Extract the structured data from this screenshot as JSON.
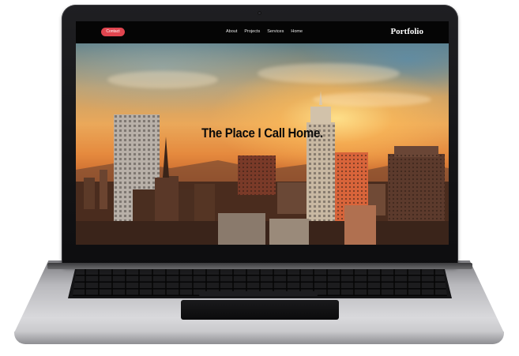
{
  "site": {
    "contact_label": "Contact",
    "nav": [
      "About",
      "Projects",
      "Services",
      "Home"
    ],
    "brand": "Portfolio"
  },
  "hero": {
    "title": "The Place I Call Home."
  },
  "colors": {
    "contact_button": "#e0454f",
    "nav_background": "#050505",
    "laptop_bezel": "#141416",
    "laptop_body": "#c9c9cc"
  }
}
